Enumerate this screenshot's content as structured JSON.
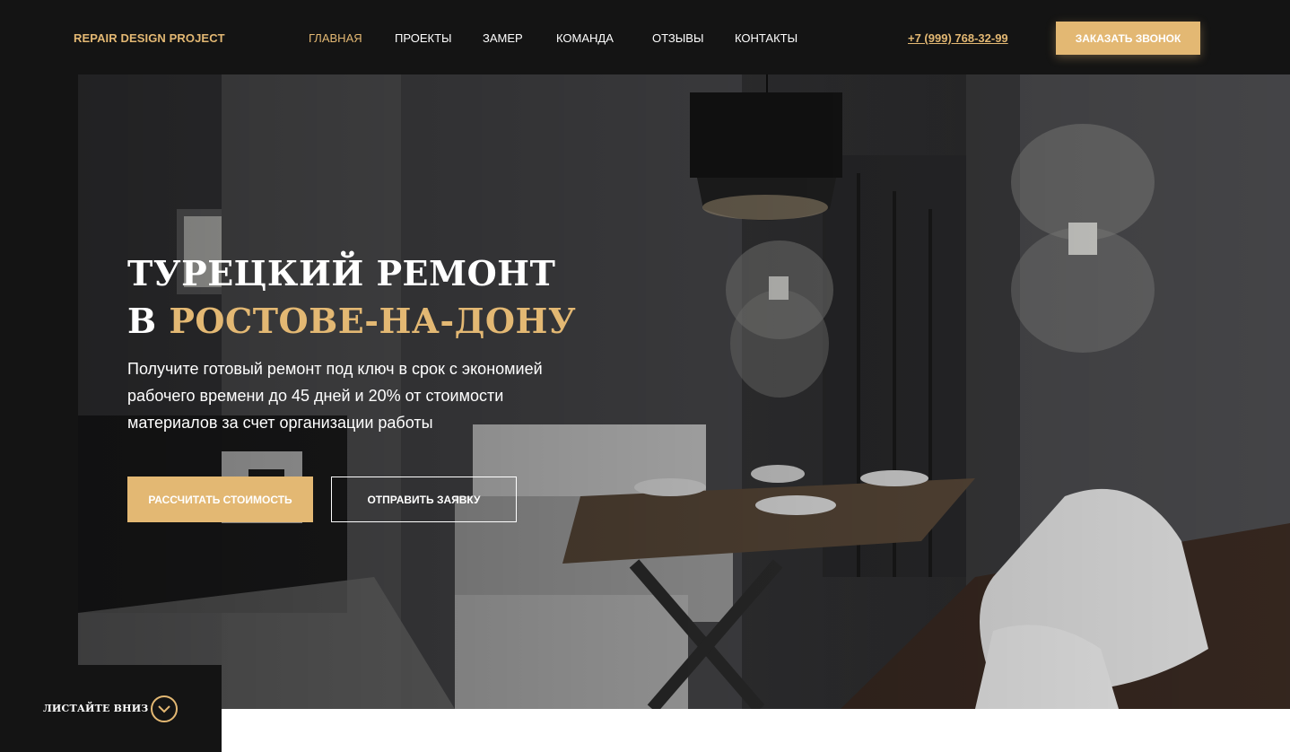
{
  "header": {
    "logo": "REPAIR DESIGN PROJECT",
    "nav": [
      {
        "label": "ГЛАВНАЯ",
        "active": true
      },
      {
        "label": "ПРОЕКТЫ",
        "active": false
      },
      {
        "label": "ЗАМЕР",
        "active": false
      },
      {
        "label": "КОМАНДА",
        "active": false
      },
      {
        "label": "ОТЗЫВЫ",
        "active": false
      },
      {
        "label": "КОНТАКТЫ",
        "active": false
      }
    ],
    "phone": "+7 (999) 768-32-99",
    "call_button": "ЗАКАЗАТЬ ЗВОНОК"
  },
  "hero": {
    "title_line1": "ТУРЕЦКИЙ РЕМОНТ",
    "title_line2_prefix": "В",
    "title_line2_accent": "РОСТОВЕ-НА-ДОНУ",
    "subtitle": "Получите готовый ремонт под ключ в срок с экономией рабочего времени до 45 дней и 20% от стоимости материалов за счет организации работы",
    "primary_button": "РАССЧИТАТЬ СТОИМОСТЬ",
    "secondary_button": "ОТПРАВИТЬ ЗАЯВКУ",
    "background_icon": "interior-photo"
  },
  "scroll": {
    "label": "ЛИСТАЙТЕ ВНИЗ",
    "icon": "chevron-down-icon"
  },
  "colors": {
    "accent": "#e3b873",
    "dark": "#141414",
    "white": "#ffffff"
  }
}
